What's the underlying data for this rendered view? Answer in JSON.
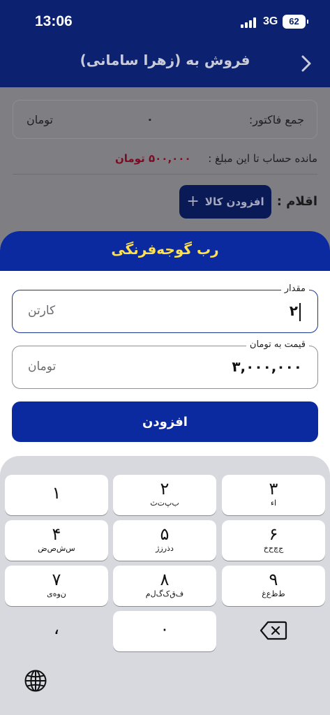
{
  "status_bar": {
    "time": "13:06",
    "network": "3G",
    "battery": "62"
  },
  "header": {
    "title": "فروش به (زهرا سامانی)"
  },
  "summary": {
    "invoice_total_label": "جمع فاکتور:",
    "invoice_total_value": "۰",
    "invoice_total_unit": "تومان"
  },
  "balance": {
    "label": "مانده حساب تا این مبلغ :",
    "value": "۵۰۰,۰۰۰ تومان"
  },
  "items": {
    "label": "اقلام :",
    "add_button": "افزودن کالا"
  },
  "sheet": {
    "title": "رب گوجه‌فرنگی",
    "quantity": {
      "label": "مقدار",
      "value": "۲",
      "unit": "کارتن"
    },
    "price": {
      "label": "قیمت به تومان",
      "value": "۳,۰۰۰,۰۰۰",
      "unit": "تومان"
    },
    "submit_button": "افزودن"
  },
  "keyboard": {
    "keys": [
      {
        "digit": "۱",
        "letters": ""
      },
      {
        "digit": "۲",
        "letters": "ب‌پ‌ت‌ث"
      },
      {
        "digit": "۳",
        "letters": "ا‌ء"
      },
      {
        "digit": "۴",
        "letters": "س‌ش‌ص‌ض"
      },
      {
        "digit": "۵",
        "letters": "د‌ذ‌ر‌ز‌ژ"
      },
      {
        "digit": "۶",
        "letters": "ج‌چ‌ح‌خ"
      },
      {
        "digit": "۷",
        "letters": "ن‌و‌ه‌ی"
      },
      {
        "digit": "۸",
        "letters": "ف‌ق‌ک‌گ‌ل‌م"
      },
      {
        "digit": "۹",
        "letters": "ط‌ظ‌ع‌غ"
      }
    ],
    "comma": "،",
    "zero": "۰"
  }
}
